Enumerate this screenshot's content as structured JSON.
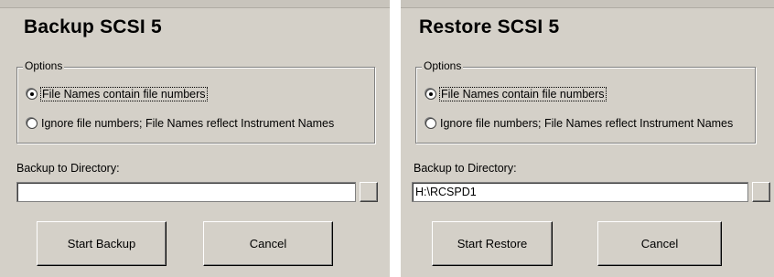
{
  "backup": {
    "title": "Backup SCSI 5",
    "options_label": "Options",
    "option_file_numbers": "File Names contain file numbers",
    "option_ignore_numbers": "Ignore file numbers; File Names reflect Instrument Names",
    "selected_option": "option_file_numbers",
    "directory_label": "Backup to Directory:",
    "directory_value": "",
    "start_button": "Start Backup",
    "cancel_button": "Cancel"
  },
  "restore": {
    "title": "Restore SCSI 5",
    "options_label": "Options",
    "option_file_numbers": "File Names contain file numbers",
    "option_ignore_numbers": "Ignore file numbers; File Names reflect Instrument Names",
    "selected_option": "option_file_numbers",
    "directory_label": "Backup to Directory:",
    "directory_value": "H:\\RCSPD1",
    "start_button": "Start Restore",
    "cancel_button": "Cancel"
  },
  "colors": {
    "dialog_background": "#d4d0c8",
    "input_background": "#ffffff"
  }
}
